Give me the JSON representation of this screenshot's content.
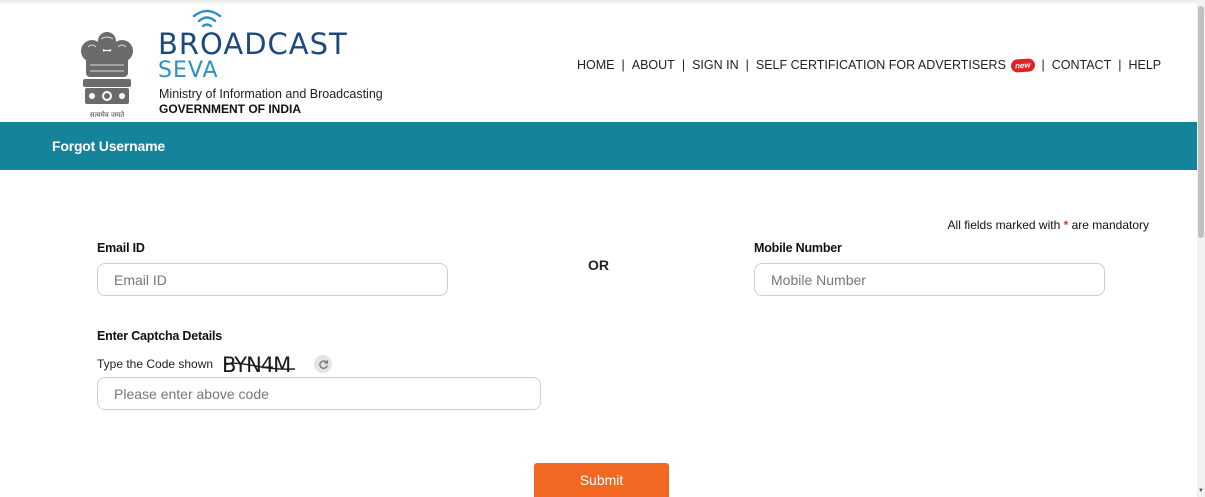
{
  "header": {
    "logo": {
      "line1": "BROADCAST",
      "line2": "SEVA",
      "ministry": "Ministry of Information and Broadcasting",
      "government": "GOVERNMENT OF INDIA",
      "emblem_caption": "सत्यमेव जयते"
    },
    "nav": {
      "home": "HOME",
      "about": "ABOUT",
      "sign_in": "SIGN IN",
      "self_cert": "SELF CERTIFICATION FOR ADVERTISERS",
      "new_badge": "new",
      "contact": "CONTACT",
      "help": "HELP",
      "separator": "|"
    }
  },
  "title_bar": {
    "title": "Forgot Username",
    "color": "#15849b"
  },
  "form": {
    "mandatory_prefix": "All fields marked with",
    "mandatory_star": "*",
    "mandatory_suffix": "are mandatory",
    "email": {
      "label": "Email ID",
      "placeholder": "Email ID",
      "value": ""
    },
    "or_text": "OR",
    "mobile": {
      "label": "Mobile Number",
      "placeholder": "Mobile Number",
      "value": ""
    },
    "captcha": {
      "heading": "Enter Captcha Details",
      "prompt": "Type the Code shown",
      "code": "BYN4M",
      "placeholder": "Please enter above code",
      "value": ""
    },
    "submit_label": "Submit",
    "submit_color": "#f26722"
  }
}
